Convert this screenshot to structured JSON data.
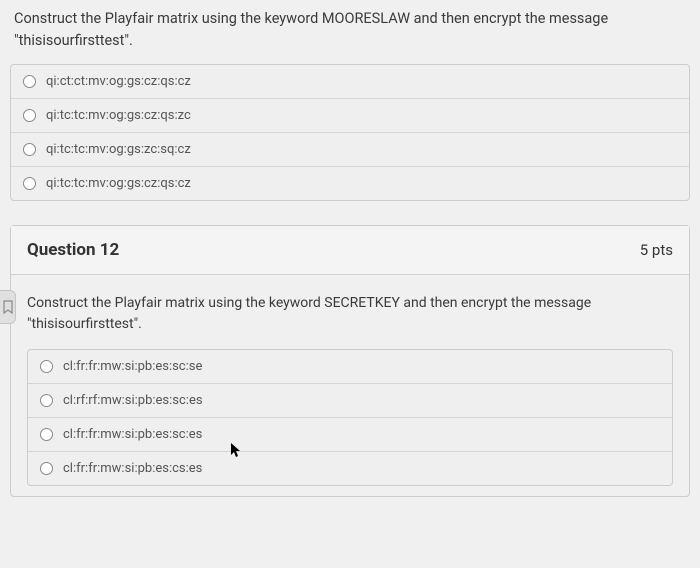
{
  "q11": {
    "prompt": "Construct the Playfair matrix using the keyword MOORESLAW and then encrypt the message \"thisisourfirsttest\".",
    "options": [
      "qi:ct:ct:mv:og:gs:cz:qs:cz",
      "qi:tc:tc:mv:og:gs:cz:qs:zc",
      "qi:tc:tc:mv:og:gs:zc:sq:cz",
      "qi:tc:tc:mv:og:gs:cz:qs:cz"
    ]
  },
  "q12": {
    "title": "Question 12",
    "points": "5 pts",
    "prompt": "Construct the Playfair matrix using the keyword SECRETKEY and then encrypt the message \"thisisourfirsttest\".",
    "options": [
      "cl:fr:fr:mw:si:pb:es:sc:se",
      "cl:rf:rf:mw:si:pb:es:sc:es",
      "cl:fr:fr:mw:si:pb:es:sc:es",
      "cl:fr:fr:mw:si:pb:es:cs:es"
    ]
  }
}
